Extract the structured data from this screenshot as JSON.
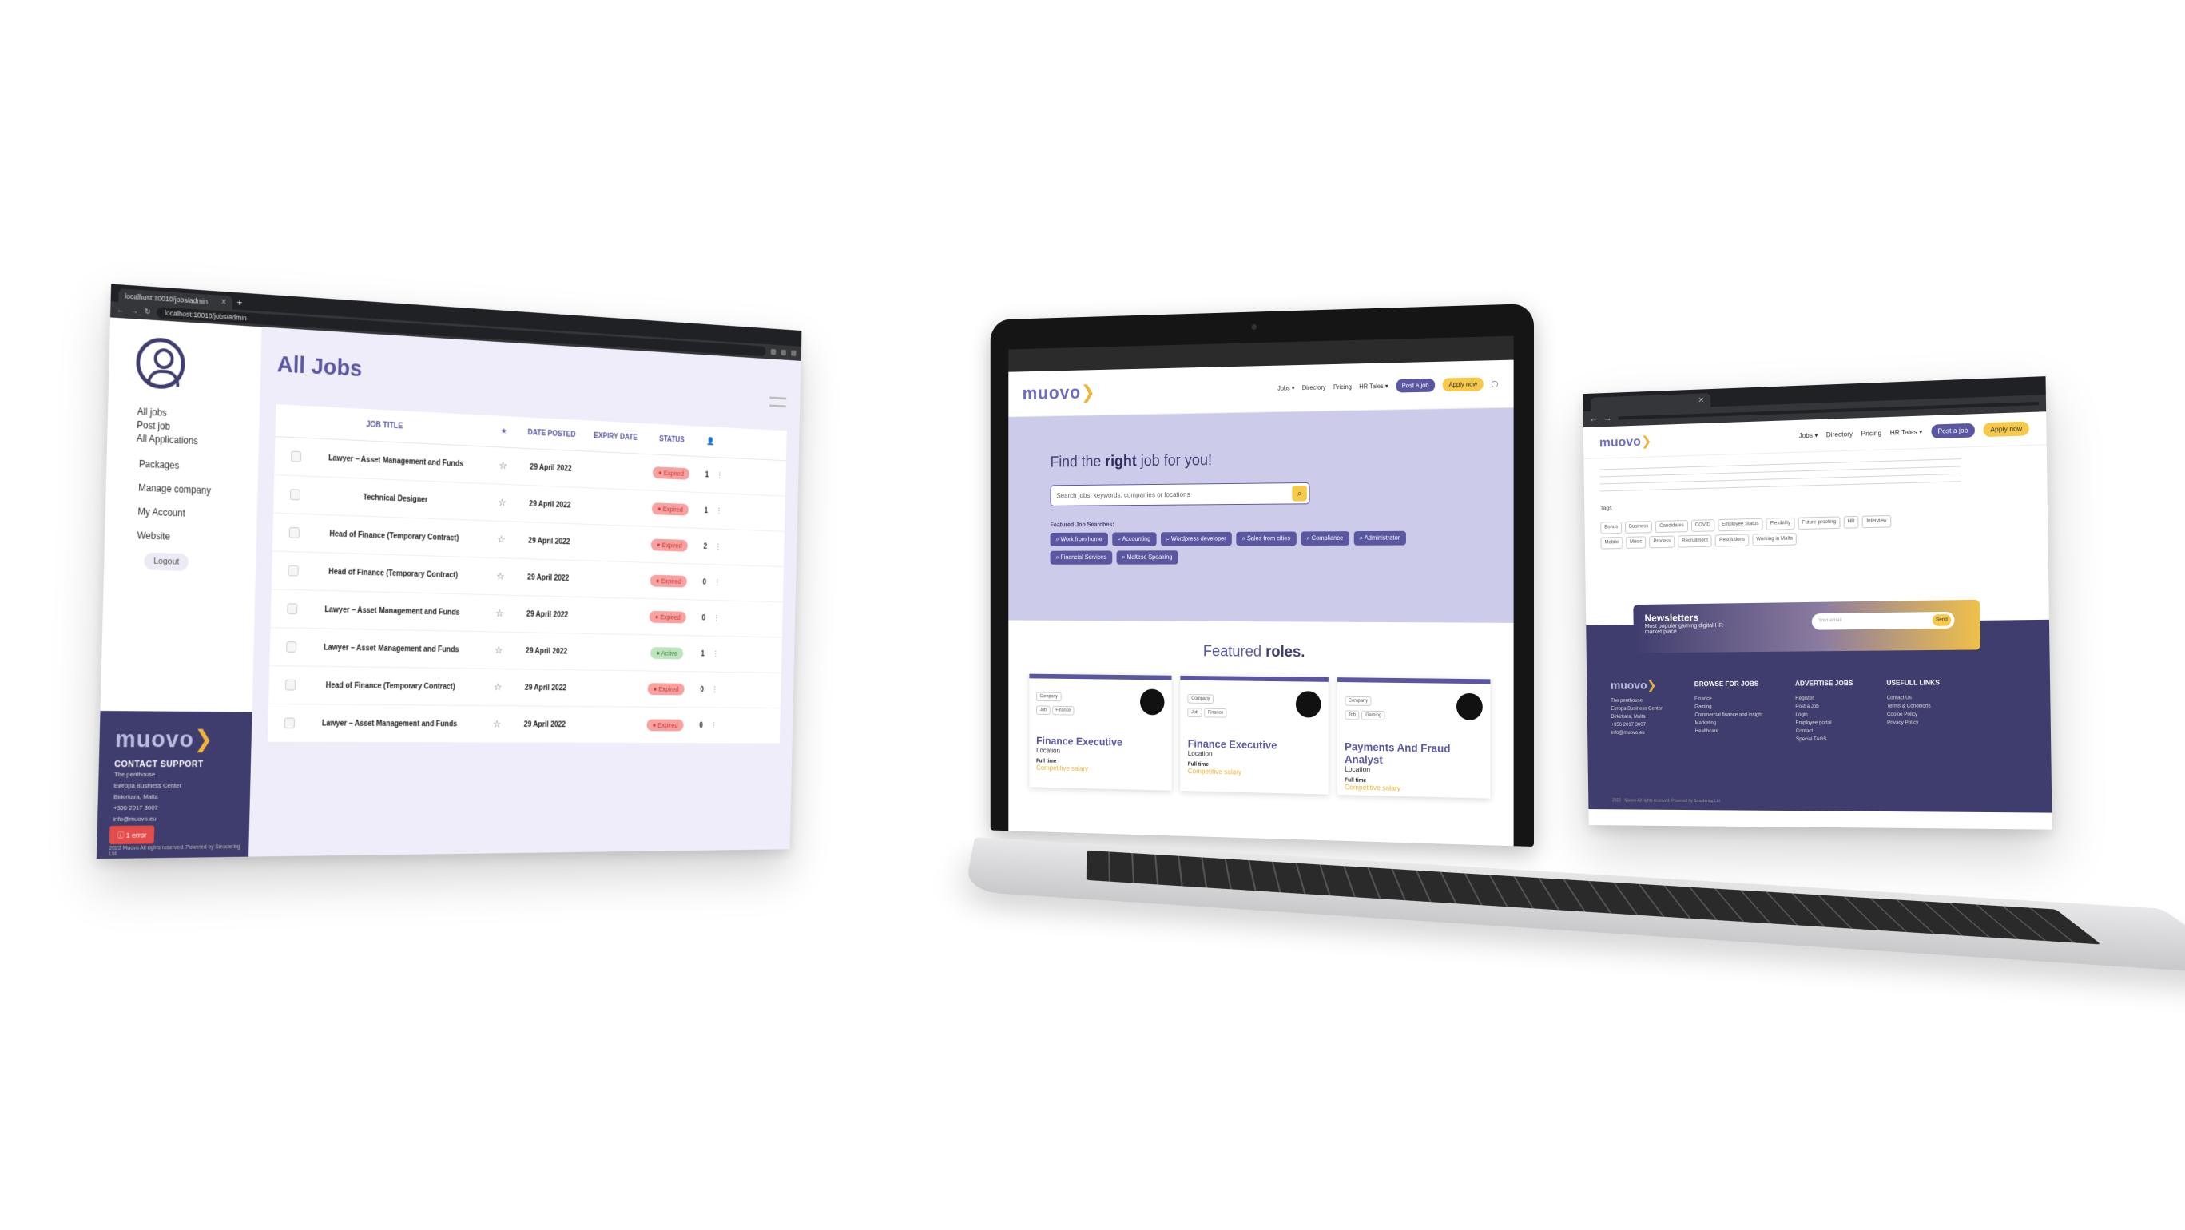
{
  "left": {
    "tab": "localhost:10010/jobs/admin",
    "url": "localhost:10010/jobs/admin",
    "nav_top": [
      "All jobs",
      "Post job",
      "All Applications"
    ],
    "nav_bottom": [
      "Packages",
      "Manage company",
      "My Account",
      "Website"
    ],
    "logout": "Logout",
    "title": "All Jobs",
    "columns": {
      "title": "JOB TITLE",
      "star": "★",
      "posted": "DATE POSTED",
      "expiry": "EXPIRY DATE",
      "status": "STATUS"
    },
    "rows": [
      {
        "title": "Lawyer – Asset Management and Funds",
        "date": "29 April 2022",
        "status": "Expired",
        "count": "1"
      },
      {
        "title": "Technical Designer",
        "date": "29 April 2022",
        "status": "Expired",
        "count": "1"
      },
      {
        "title": "Head of Finance (Temporary Contract)",
        "date": "29 April 2022",
        "status": "Expired",
        "count": "2"
      },
      {
        "title": "Head of Finance (Temporary Contract)",
        "date": "29 April 2022",
        "status": "Expired",
        "count": "0"
      },
      {
        "title": "Lawyer – Asset Management and Funds",
        "date": "29 April 2022",
        "status": "Expired",
        "count": "0"
      },
      {
        "title": "Lawyer – Asset Management and Funds",
        "date": "29 April 2022",
        "status": "Active",
        "count": "1"
      },
      {
        "title": "Head of Finance (Temporary Contract)",
        "date": "29 April 2022",
        "status": "Expired",
        "count": "0"
      },
      {
        "title": "Lawyer – Asset Management and Funds",
        "date": "29 April 2022",
        "status": "Expired",
        "count": "0"
      }
    ],
    "footer": {
      "logo": "muovo",
      "contact_title": "CONTACT SUPPORT",
      "lines": [
        "The penthouse",
        "Ewropa Business Center",
        "Birkirkara, Malta",
        "+356 2017 3007",
        "info@muovo.eu"
      ],
      "error": "1 error",
      "copyright": "2022 Muovo All rights reserved. Powered by Smudering Ltd."
    }
  },
  "center": {
    "logo": "muovo",
    "nav": [
      "Jobs ▾",
      "Directory",
      "Pricing",
      "HR Tales ▾"
    ],
    "post_btn": "Post a job",
    "apply_btn": "Apply now",
    "hero_pre": "Find the ",
    "hero_bold": "right",
    "hero_post": " job for you!",
    "search_placeholder": "Search jobs, keywords, companies or locations",
    "featured_label": "Featured Job Searches:",
    "chips": [
      "Work from home",
      "Accounting",
      "Wordpress developer",
      "Sales from cities",
      "Compliance",
      "Administrator",
      "Financial Services",
      "Maltese Speaking"
    ],
    "roles_pre": "Featured ",
    "roles_bold": "roles.",
    "cards": [
      {
        "tags": [
          "Company",
          "Job",
          "Finance"
        ],
        "title": "Finance Executive",
        "location": "Location",
        "type": "Full time",
        "salary": "Competitive salary"
      },
      {
        "tags": [
          "Company",
          "Job",
          "Finance"
        ],
        "title": "Finance Executive",
        "location": "Location",
        "type": "Full time",
        "salary": "Competitive salary"
      },
      {
        "tags": [
          "Company",
          "Job",
          "Gaming"
        ],
        "title": "Payments And Fraud Analyst",
        "location": "Location",
        "type": "Full time",
        "salary": "Competitive salary"
      }
    ]
  },
  "right": {
    "logo": "muovo",
    "nav": [
      "Jobs ▾",
      "Directory",
      "Pricing",
      "HR Tales ▾"
    ],
    "post_btn": "Post a job",
    "apply_btn": "Apply now",
    "tags_label": "Tags",
    "tags": [
      "Bonus",
      "Business",
      "Candidates",
      "COVID",
      "Employee Status",
      "Flexibility",
      "Future-proofing",
      "HR",
      "Interview",
      "Mobile",
      "Music",
      "Process",
      "Recruitment",
      "Resolutions",
      "Working in Malta"
    ],
    "newsletter_title": "Newsletters",
    "newsletter_sub": "Most popular gaming digital HR market place",
    "newsletter_placeholder": "Your email",
    "newsletter_btn": "Send",
    "footer_logo": "muovo",
    "footer_cols": [
      {
        "h": "BROWSE FOR JOBS",
        "items": [
          "Finance",
          "Gaming",
          "Commercial finance and insight",
          "Marketing",
          "Healthcare"
        ]
      },
      {
        "h": "ADVERTISE JOBS",
        "items": [
          "Register",
          "Post a Job",
          "Login",
          "Employee portal",
          "Contact",
          "Special TAGS"
        ]
      },
      {
        "h": "USEFULL LINKS",
        "items": [
          "Contact Us",
          "Terms & Conditions",
          "Cookie Policy",
          "Privacy Policy"
        ]
      }
    ],
    "footer_address": [
      "The penthouse",
      "Europa Business Center",
      "Birkirkara, Malta",
      "+356 2017 3007",
      "info@muovo.eu"
    ],
    "copyright": "2022 · Muovo All rights reserved. Powered by Smudering Ltd."
  }
}
